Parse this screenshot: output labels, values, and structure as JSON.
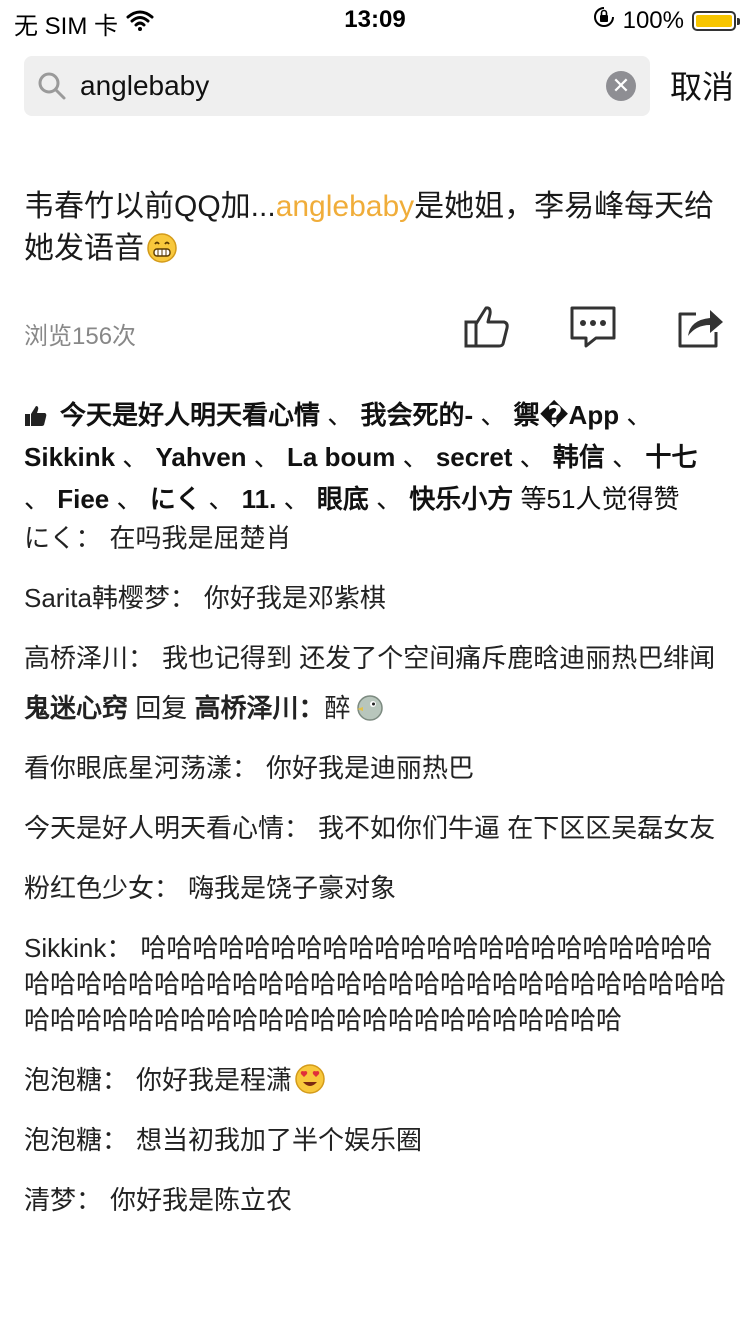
{
  "status": {
    "carrier": "无 SIM 卡",
    "time": "13:09",
    "battery": "100%",
    "battery_level": 1.0,
    "battery_color": "#f7c500"
  },
  "search": {
    "query": "anglebaby",
    "cancel_label": "取消"
  },
  "post": {
    "title_prefix": "韦春竹以前QQ加...",
    "title_highlight": "anglebaby",
    "title_suffix": "是她姐，李易峰每天给她发语音",
    "title_emoji": "grin-emoji",
    "highlight_color": "#f0ad3a",
    "views": "浏览156次"
  },
  "actions": [
    "like-icon",
    "comment-icon",
    "share-icon"
  ],
  "likes": {
    "names": [
      "今天是好人明天看心情",
      "我会死的-",
      "禦�App",
      "Sikkink",
      "Yahven",
      "La boum",
      "secret",
      "韩信",
      "十七",
      "Fiee",
      "にく",
      "11.",
      "眼底",
      "快乐小方"
    ],
    "summary": "等51人觉得赞"
  },
  "comments": [
    {
      "name": "にく：",
      "text": "在吗我是屈楚肖"
    },
    {
      "name": "Sarita韩樱梦：",
      "text": "你好我是邓紫棋"
    },
    {
      "name": "高桥泽川：",
      "text": "我也记得到 还发了个空间痛斥鹿晗迪丽热巴绯闻"
    }
  ],
  "reply": {
    "from": "鬼迷心窍",
    "verb": "回复",
    "to": "高桥泽川：",
    "text": "醉"
  },
  "comments2": [
    {
      "name": "看你眼底星河荡漾：",
      "text": "你好我是迪丽热巴"
    },
    {
      "name": "今天是好人明天看心情：",
      "text": "我不如你们牛逼 在下区区吴磊女友"
    },
    {
      "name": "粉红色少女：",
      "text": "嗨我是饶子豪对象"
    },
    {
      "name": "Sikkink：",
      "text": "哈哈哈哈哈哈哈哈哈哈哈哈哈哈哈哈哈哈哈哈哈哈哈哈哈哈哈哈哈哈哈哈哈哈哈哈哈哈哈哈哈哈哈哈哈哈哈哈哈哈哈哈哈哈哈哈哈哈哈哈哈哈哈哈哈哈哈哈哈哈哈哈"
    },
    {
      "name": "泡泡糖：",
      "text": "你好我是程潇"
    },
    {
      "name": "泡泡糖：",
      "text": "想当初我加了半个娱乐圈"
    },
    {
      "name": "清梦：",
      "text": "你好我是陈立农"
    }
  ]
}
